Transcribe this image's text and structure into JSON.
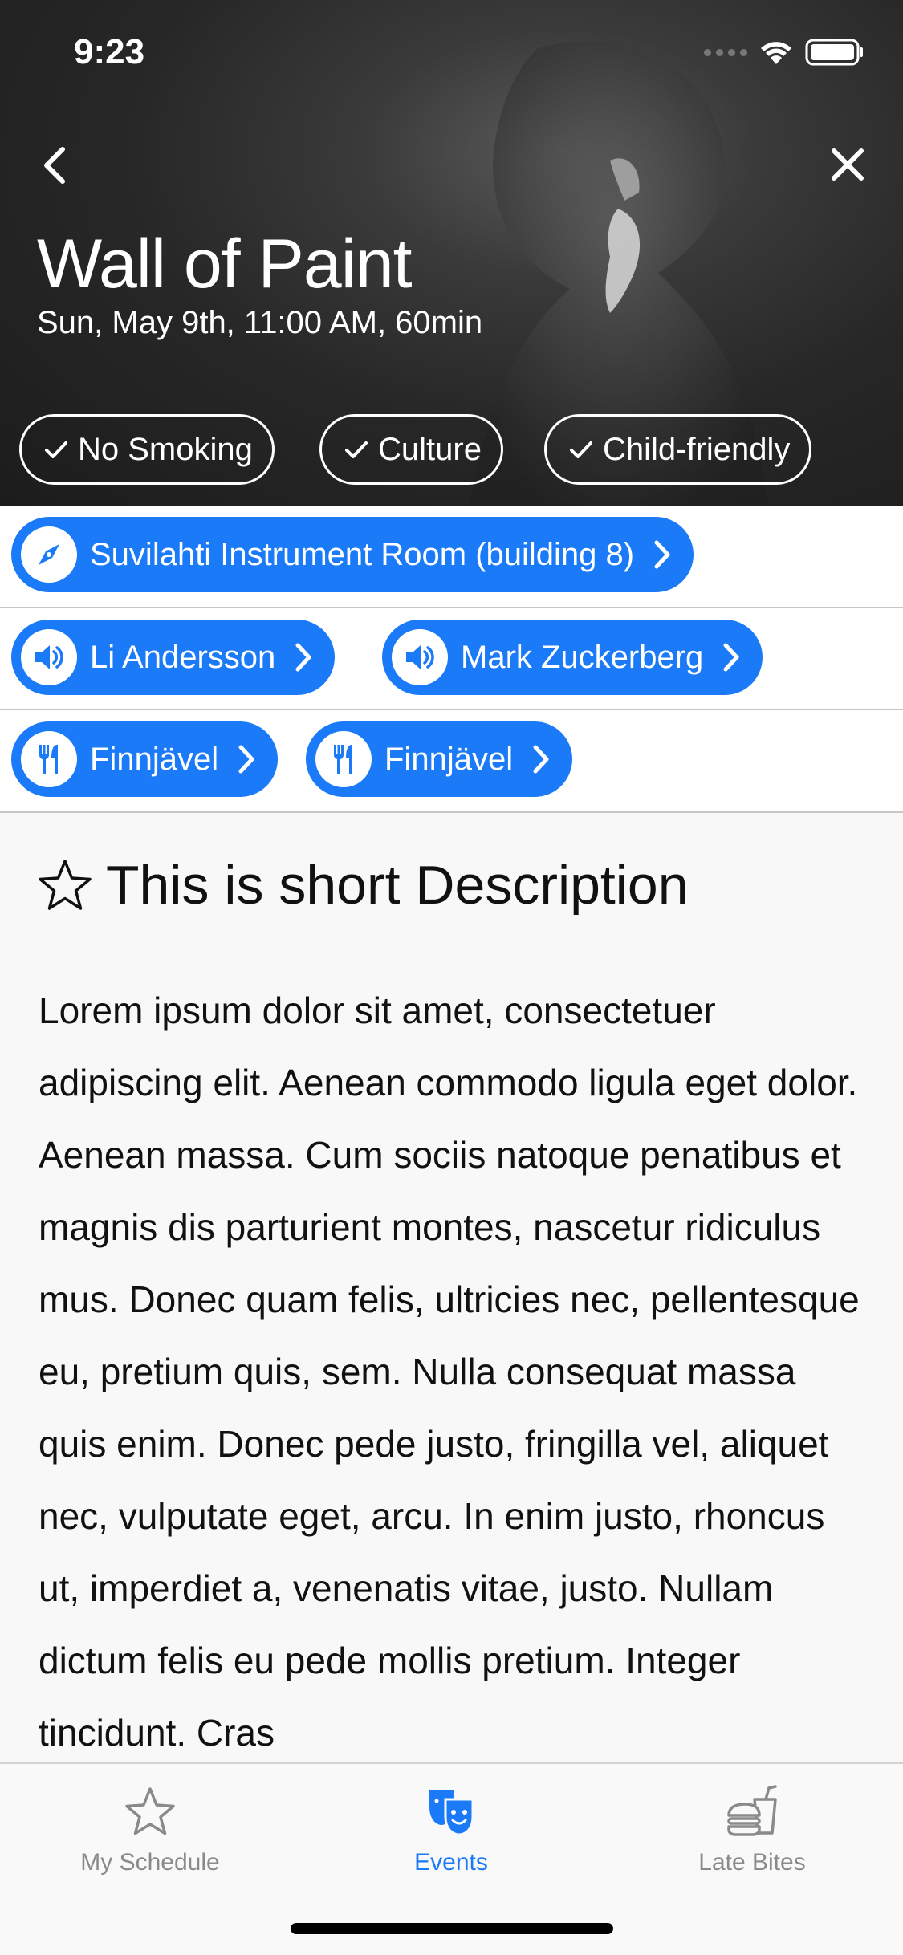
{
  "status": {
    "time": "9:23"
  },
  "event": {
    "title": "Wall of Paint",
    "datetime": "Sun, May 9th, 11:00 AM, 60min"
  },
  "tags": [
    {
      "label": "No Smoking",
      "icon": "checkmark-icon"
    },
    {
      "label": "Culture",
      "icon": "checkmark-icon"
    },
    {
      "label": "Child-friendly",
      "icon": "checkmark-icon"
    }
  ],
  "location": {
    "label": "Suvilahti Instrument Room (building 8)",
    "icon": "compass-icon"
  },
  "performers": [
    {
      "label": "Li Andersson",
      "icon": "speaker-icon"
    },
    {
      "label": "Mark Zuckerberg",
      "icon": "speaker-icon"
    }
  ],
  "food": [
    {
      "label": "Finnjävel",
      "icon": "fork-knife-icon"
    },
    {
      "label": "Finnjävel",
      "icon": "fork-knife-icon"
    }
  ],
  "description": {
    "title": "This is short Description",
    "body": "Lorem ipsum dolor sit amet, consectetuer adipiscing elit. Aenean commodo ligula eget dolor. Aenean massa. Cum sociis natoque penatibus et magnis dis parturient montes, nascetur ridiculus mus. Donec quam felis, ultricies nec, pellentesque eu, pretium quis, sem. Nulla consequat massa quis enim. Donec pede justo, fringilla vel, aliquet nec, vulputate eget, arcu. In enim justo, rhoncus ut, imperdiet a, venenatis vitae, justo. Nullam dictum felis eu pede mollis pretium. Integer tincidunt. Cras"
  },
  "tabbar": [
    {
      "label": "My Schedule",
      "icon": "star-icon",
      "active": false
    },
    {
      "label": "Events",
      "icon": "theater-masks-icon",
      "active": true
    },
    {
      "label": "Late Bites",
      "icon": "burger-drink-icon",
      "active": false
    }
  ],
  "colors": {
    "accent": "#1a7af8",
    "hero_bg": "#272727",
    "chip_text": "#ffffff"
  }
}
